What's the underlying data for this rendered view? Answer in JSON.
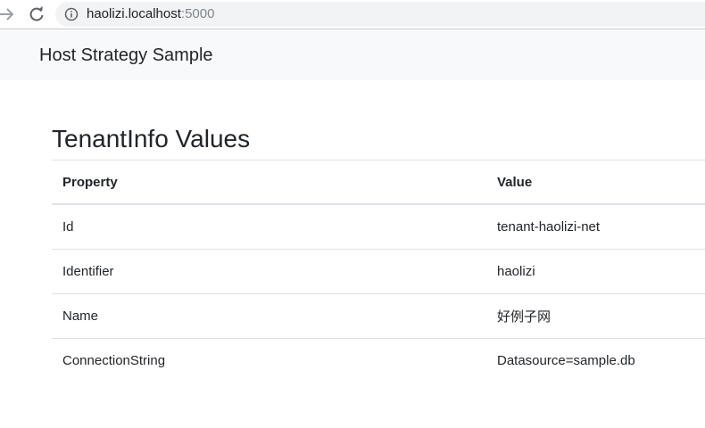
{
  "browser": {
    "url_host": "haolizi.localhost",
    "url_port": ":5000"
  },
  "header": {
    "brand": "Host Strategy Sample"
  },
  "main": {
    "title": "TenantInfo Values",
    "table": {
      "headers": [
        "Property",
        "Value"
      ],
      "rows": [
        {
          "property": "Id",
          "value": "tenant-haolizi-net"
        },
        {
          "property": "Identifier",
          "value": "haolizi"
        },
        {
          "property": "Name",
          "value": "好例子网"
        },
        {
          "property": "ConnectionString",
          "value": "Datasource=sample.db"
        }
      ]
    }
  },
  "icons": {
    "forward": "forward-arrow-icon",
    "reload": "reload-icon",
    "info": "info-icon"
  }
}
